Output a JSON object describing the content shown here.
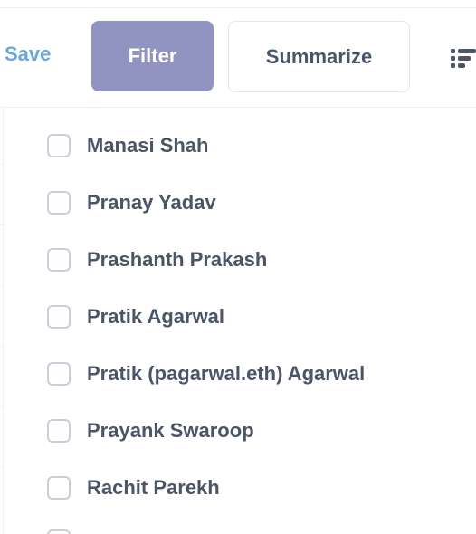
{
  "toolbar": {
    "save_label": "Save",
    "filter_label": "Filter",
    "summarize_label": "Summarize",
    "list_icon": "list-icon"
  },
  "filter_options": [
    {
      "label": "Manasi Shah",
      "checked": false
    },
    {
      "label": "Pranay Yadav",
      "checked": false
    },
    {
      "label": "Prashanth Prakash",
      "checked": false
    },
    {
      "label": "Pratik Agarwal",
      "checked": false
    },
    {
      "label": "Pratik (pagarwal.eth) Agarwal",
      "checked": false
    },
    {
      "label": "Prayank Swaroop",
      "checked": false
    },
    {
      "label": "Rachit Parekh",
      "checked": false
    }
  ],
  "colors": {
    "filter_button_bg": "#9193c1",
    "save_link": "#6aa7d9",
    "text": "#4c5468",
    "checkbox_border": "#c9ced8"
  }
}
